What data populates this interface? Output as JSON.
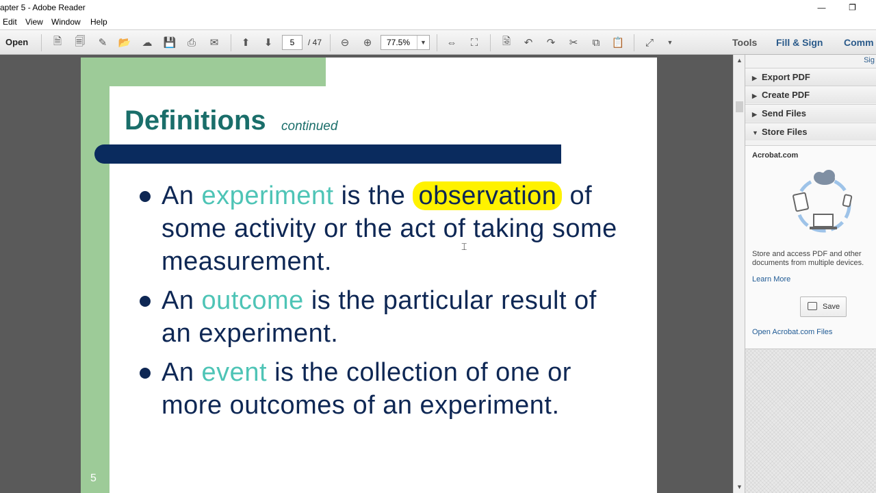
{
  "window": {
    "title": "apter 5 - Adobe Reader",
    "minimize": "—",
    "restore": "❐"
  },
  "menu": [
    "Edit",
    "View",
    "Window",
    "Help"
  ],
  "toolbar": {
    "open_label": "Open",
    "page_current": "5",
    "page_total": "/ 47",
    "zoom": "77.5%",
    "tools_label": "Tools",
    "fill_sign_label": "Fill & Sign",
    "comment_label": "Comm"
  },
  "slide": {
    "title": "Definitions",
    "subtitle": "continued",
    "bullets": [
      {
        "pre": "An ",
        "term": "experiment",
        "mid": " is the ",
        "highlight": "observation",
        "post": " of some activity or the act of taking some measurement."
      },
      {
        "pre": "An ",
        "term": "outcome",
        "post": " is the particular result of an experiment."
      },
      {
        "pre": "An ",
        "term": "event",
        "post": " is the collection of one or more outcomes of an experiment."
      }
    ],
    "number": "5"
  },
  "panel": {
    "sig_label": "Sig",
    "sections": [
      {
        "label": "Export PDF",
        "expanded": false
      },
      {
        "label": "Create PDF",
        "expanded": false
      },
      {
        "label": "Send Files",
        "expanded": false
      },
      {
        "label": "Store Files",
        "expanded": true
      }
    ],
    "acrobat_label": "Acrobat.com",
    "description": "Store and access PDF and other documents from multiple devices.",
    "learn_more": "Learn More",
    "save_label": "Save",
    "open_files": "Open Acrobat.com Files"
  },
  "colors": {
    "title_teal": "#1a6e6a",
    "term_teal": "#4ec4b6",
    "body_navy": "#0e2754",
    "highlight": "#fff200",
    "accent_green": "#9dcb98"
  }
}
